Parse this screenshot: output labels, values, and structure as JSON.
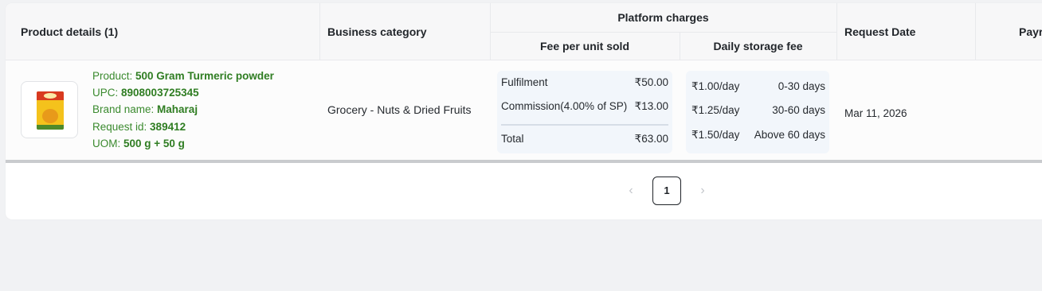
{
  "table": {
    "headers": {
      "product_details": "Product details (1)",
      "business_category": "Business category",
      "platform_charges": "Platform charges",
      "fee_per_unit": "Fee per unit sold",
      "daily_storage": "Daily storage fee",
      "request_date": "Request Date",
      "payment_partial": "Payr"
    },
    "row": {
      "product_label": "Product: ",
      "product_value": "500 Gram Turmeric powder",
      "upc_label": "UPC: ",
      "upc_value": "8908003725345",
      "brand_label": "Brand name: ",
      "brand_value": "Maharaj",
      "request_id_label": "Request id: ",
      "request_id_value": "389412",
      "uom_label": "UOM: ",
      "uom_value": "500 g + 50 g",
      "business_category": "Grocery - Nuts & Dried Fruits",
      "fees": {
        "fulfilment_label": "Fulfilment",
        "fulfilment_value": "₹50.00",
        "commission_label": "Commission(4.00% of SP)",
        "commission_value": "₹13.00",
        "total_label": "Total",
        "total_value": "₹63.00"
      },
      "storage": [
        {
          "rate": "₹1.00/day",
          "range": "0-30 days"
        },
        {
          "rate": "₹1.25/day",
          "range": "30-60 days"
        },
        {
          "rate": "₹1.50/day",
          "range": "Above 60 days"
        }
      ],
      "request_date": "Mar 11, 2026"
    }
  },
  "pagination": {
    "prev": "‹",
    "current": "1",
    "next": "›"
  },
  "icons": {
    "product_image": "turmeric-pack-icon",
    "prev": "chevron-left-icon",
    "next": "chevron-right-icon"
  }
}
